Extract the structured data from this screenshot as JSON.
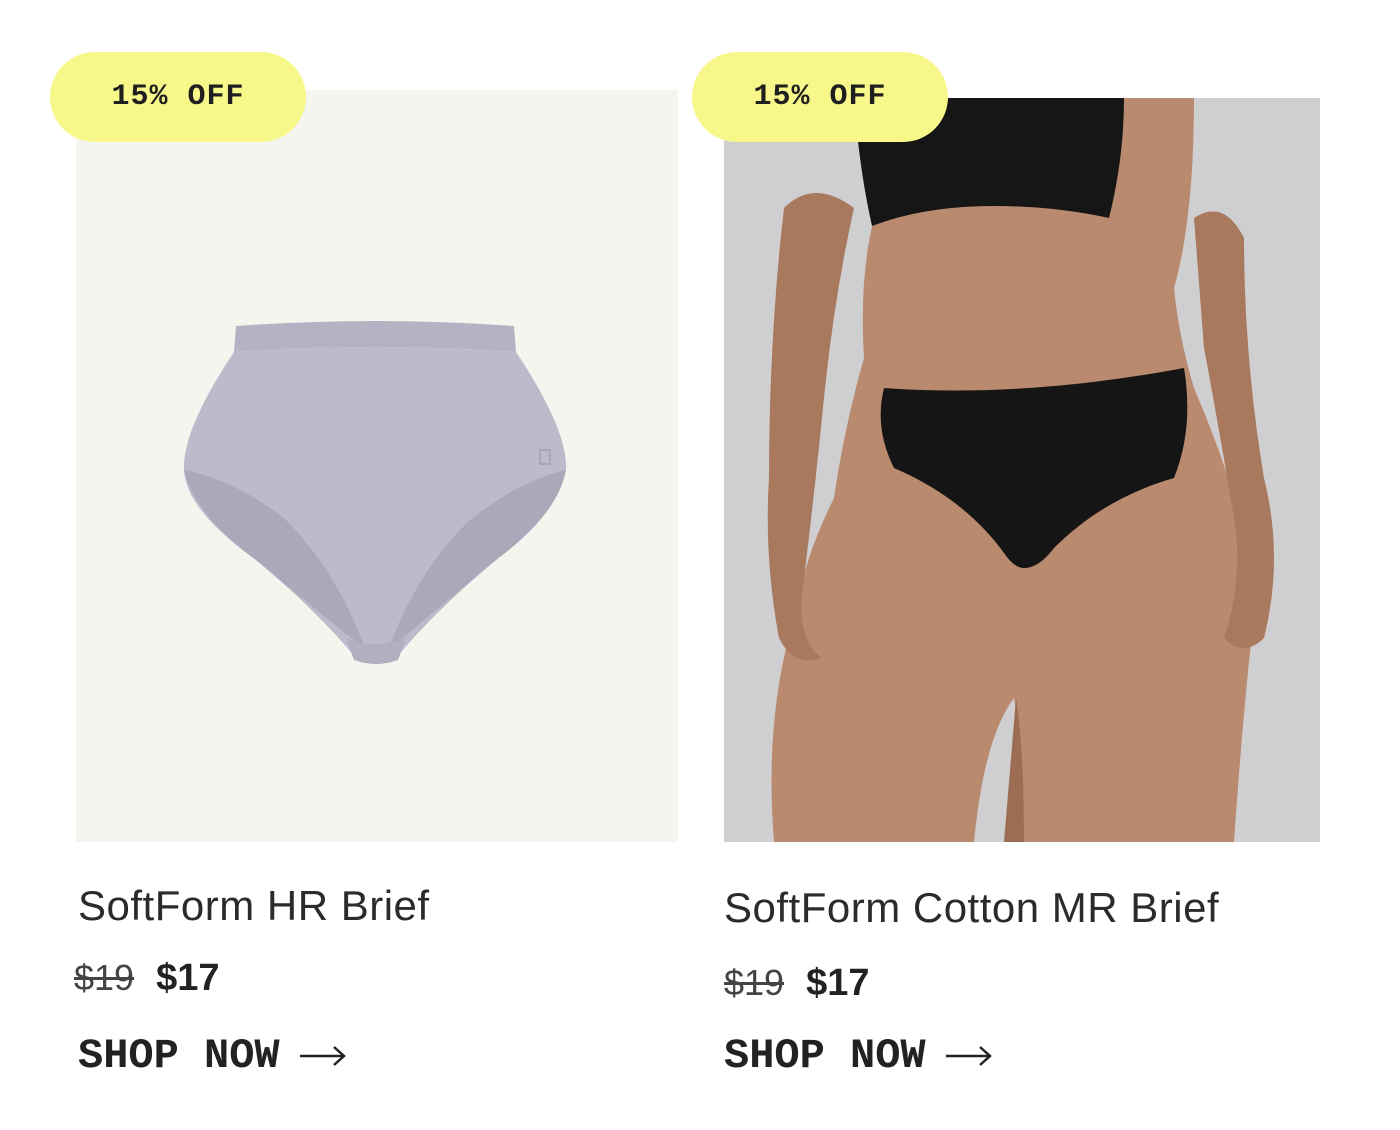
{
  "products": [
    {
      "badge": "15% OFF",
      "image_alt": "lavender high-rise brief",
      "title": "SoftForm HR Brief",
      "price_old": "$19",
      "price_new": "$17",
      "cta": "SHOP NOW",
      "badge_color": "#f7f78a",
      "image_bg": "#f4f5ef",
      "garment_color": "#b9b9c9"
    },
    {
      "badge": "15% OFF",
      "image_alt": "model wearing black brief",
      "title": "SoftForm Cotton MR Brief",
      "price_old": "$19",
      "price_new": "$17",
      "cta": "SHOP NOW",
      "badge_color": "#f7f78a",
      "image_bg": "#cfcfd1",
      "garment_color": "#151515"
    }
  ]
}
